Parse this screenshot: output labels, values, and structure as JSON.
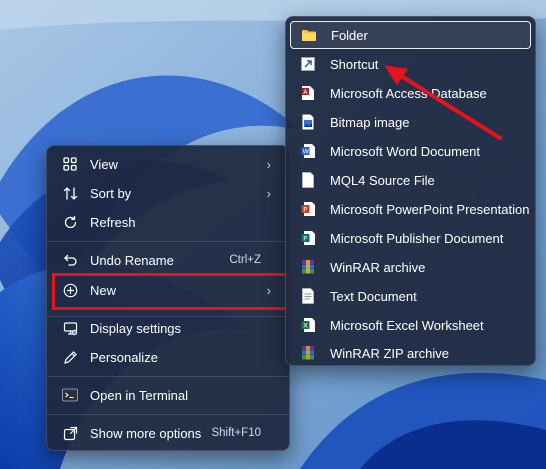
{
  "context_menu": {
    "items": [
      {
        "label": "View",
        "icon": "grid-icon",
        "has_submenu": true
      },
      {
        "label": "Sort by",
        "icon": "sort-icon",
        "has_submenu": true
      },
      {
        "label": "Refresh",
        "icon": "refresh-icon"
      },
      {
        "label": "Undo Rename",
        "icon": "undo-icon",
        "shortcut": "Ctrl+Z"
      },
      {
        "label": "New",
        "icon": "add-circle-icon",
        "has_submenu": true,
        "highlighted": true
      },
      {
        "label": "Display settings",
        "icon": "display-icon"
      },
      {
        "label": "Personalize",
        "icon": "pen-icon"
      },
      {
        "label": "Open in Terminal",
        "icon": "terminal-icon"
      },
      {
        "label": "Show more options",
        "icon": "share-icon",
        "shortcut": "Shift+F10"
      }
    ]
  },
  "new_submenu": {
    "items": [
      {
        "label": "Folder",
        "icon": "folder-icon",
        "active": true
      },
      {
        "label": "Shortcut",
        "icon": "shortcut-icon"
      },
      {
        "label": "Microsoft Access Database",
        "icon": "access-icon"
      },
      {
        "label": "Bitmap image",
        "icon": "bitmap-icon"
      },
      {
        "label": "Microsoft Word Document",
        "icon": "word-icon"
      },
      {
        "label": "MQL4 Source File",
        "icon": "file-icon"
      },
      {
        "label": "Microsoft PowerPoint Presentation",
        "icon": "powerpoint-icon"
      },
      {
        "label": "Microsoft Publisher Document",
        "icon": "publisher-icon"
      },
      {
        "label": "WinRAR archive",
        "icon": "winrar-icon"
      },
      {
        "label": "Text Document",
        "icon": "text-document-icon"
      },
      {
        "label": "Microsoft Excel Worksheet",
        "icon": "excel-icon"
      },
      {
        "label": "WinRAR ZIP archive",
        "icon": "winrar-zip-icon"
      }
    ]
  },
  "colors": {
    "highlight_box": "#e4141d",
    "annotation_arrow": "#e4141d",
    "menu_background": "#1e283e"
  }
}
